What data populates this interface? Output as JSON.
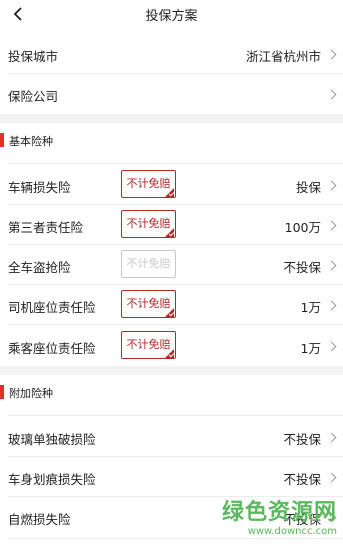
{
  "nav": {
    "back_icon": "chevron-left-icon",
    "title": "投保方案"
  },
  "top": [
    {
      "label": "投保城市",
      "value": "浙江省杭州市"
    },
    {
      "label": "保险公司",
      "value": ""
    }
  ],
  "basic": {
    "title": "基本险种",
    "items": [
      {
        "label": "车辆损失险",
        "tag": "不计免赔",
        "checked": true,
        "value": "投保"
      },
      {
        "label": "第三者责任险",
        "tag": "不计免赔",
        "checked": true,
        "value": "100万"
      },
      {
        "label": "全车盗抢险",
        "tag": "不计免赔",
        "checked": false,
        "value": "不投保"
      },
      {
        "label": "司机座位责任险",
        "tag": "不计免赔",
        "checked": true,
        "value": "1万"
      },
      {
        "label": "乘客座位责任险",
        "tag": "不计免赔",
        "checked": true,
        "value": "1万"
      }
    ]
  },
  "additional": {
    "title": "附加险种",
    "items": [
      {
        "label": "玻璃单独破损险",
        "value": "不投保"
      },
      {
        "label": "车身划痕损失险",
        "value": "不投保"
      },
      {
        "label": "自燃损失险",
        "value": "不投保"
      }
    ]
  },
  "watermark": {
    "text": "绿色资源网",
    "url": "www.downcc.com"
  },
  "colors": {
    "accent": "#e1302a",
    "tag_red": "#b12a2a",
    "tag_off": "#c9c9c9",
    "gap": "#f2f2f2",
    "watermark": "#5cb85c"
  }
}
